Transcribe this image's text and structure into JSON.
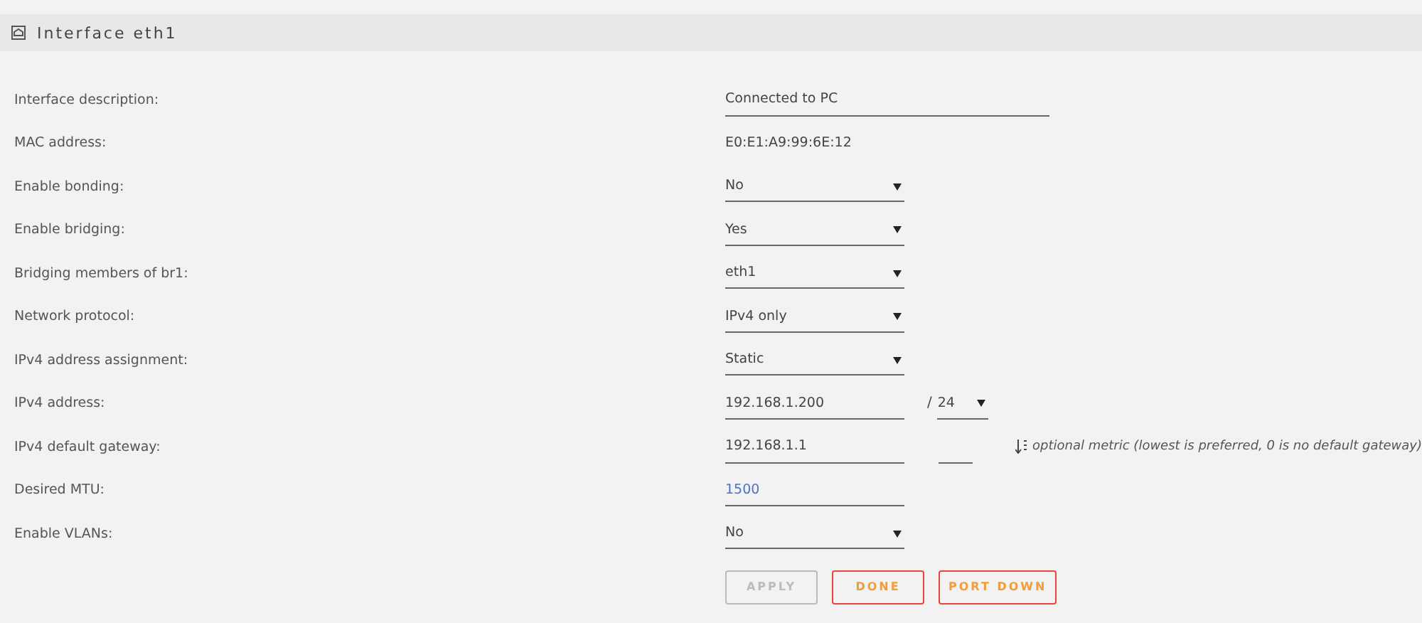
{
  "panel": {
    "title": "Interface eth1"
  },
  "rows": [
    {
      "kind": "text",
      "label": "Interface description:",
      "value": "Connected to PC"
    },
    {
      "kind": "static",
      "label": "MAC address:",
      "value": "E0:E1:A9:99:6E:12"
    },
    {
      "kind": "select",
      "label": "Enable bonding:",
      "value": "No"
    },
    {
      "kind": "select",
      "label": "Enable bridging:",
      "value": "Yes"
    },
    {
      "kind": "select",
      "label": "Bridging members of br1:",
      "value": "eth1"
    },
    {
      "kind": "select",
      "label": "Network protocol:",
      "value": "IPv4 only"
    },
    {
      "kind": "select",
      "label": "IPv4 address assignment:",
      "value": "Static"
    },
    {
      "kind": "ip",
      "label": "IPv4 address:",
      "value": "192.168.1.200",
      "separator": "/",
      "prefix": "24"
    },
    {
      "kind": "gateway",
      "label": "IPv4 default gateway:",
      "value": "192.168.1.1",
      "hint": "optional metric (lowest is preferred, 0 is no default gateway)"
    },
    {
      "kind": "number",
      "label": "Desired MTU:",
      "value": "1500"
    },
    {
      "kind": "select",
      "label": "Enable VLANs:",
      "value": "No"
    }
  ],
  "buttons": [
    {
      "label": "APPLY",
      "disabled": true
    },
    {
      "label": "DONE",
      "disabled": false
    },
    {
      "label": "PORT DOWN",
      "disabled": false
    }
  ]
}
